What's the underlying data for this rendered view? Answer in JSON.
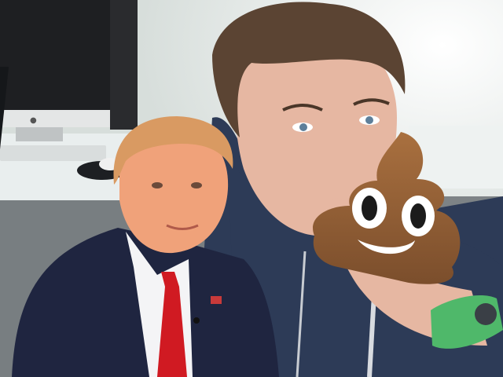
{
  "scene": {
    "background": {
      "wall": "#dfe6e3",
      "desk": "#e9eeee",
      "window_glow": "#f7faf7"
    },
    "computer": {
      "kind": "desktop-monitor",
      "color": "#1e1f22",
      "stand_color": "#bfc3c4",
      "keyboard_color": "#d9dddd",
      "mouse_color": "#f0f0f0"
    },
    "person_right": {
      "hair_color": "#5b4433",
      "skin_color": "#e6b7a2",
      "hoodie_color": "#2d3b57",
      "watch_color": "#4fb86a"
    },
    "person_left": {
      "hair_color": "#d99a62",
      "skin_color": "#f0a27a",
      "suit_color": "#1f2540",
      "shirt_color": "#f4f4f6",
      "tie_color": "#d01a22"
    },
    "sticker": {
      "icon": "pile-of-poo-emoji",
      "color": "#8a5a34",
      "highlight": "#a9703f"
    }
  }
}
